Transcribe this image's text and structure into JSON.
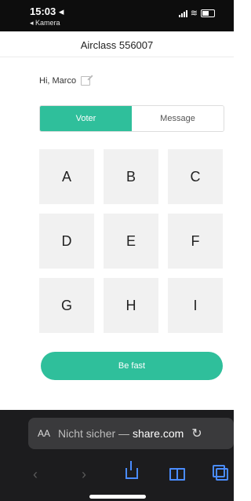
{
  "status": {
    "time": "15:03 ◂",
    "back_label": "◂ Kamera"
  },
  "app": {
    "title": "Airclass 556007",
    "greeting": "Hi, Marco"
  },
  "tabs": [
    {
      "label": "Voter",
      "active": true
    },
    {
      "label": "Message",
      "active": false
    }
  ],
  "keys": [
    "A",
    "B",
    "C",
    "D",
    "E",
    "F",
    "G",
    "H",
    "I"
  ],
  "cta": {
    "label": "Be fast"
  },
  "browser": {
    "text_size_label": "AA",
    "url_prefix": "Nicht sicher — ",
    "url_domain": "share.com",
    "reload_icon": "reload-icon"
  },
  "colors": {
    "accent": "#2fbf9b",
    "key_bg": "#f1f1f1",
    "browser_bg": "#1c1c1e"
  }
}
